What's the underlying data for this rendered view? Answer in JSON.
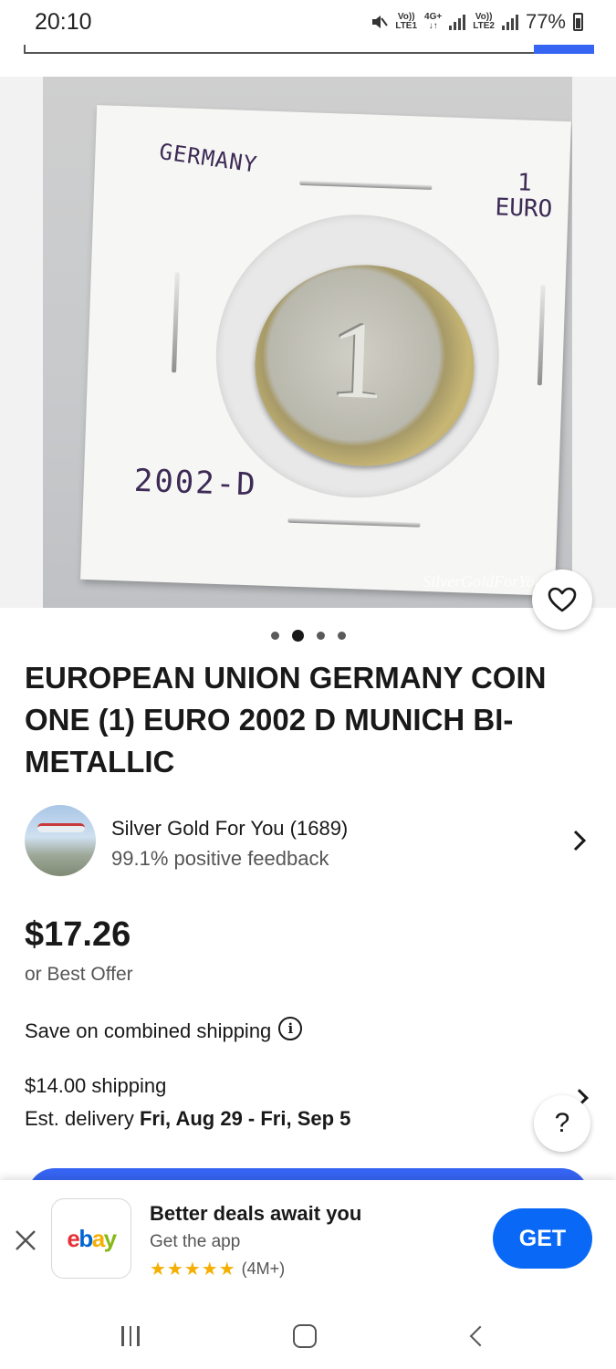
{
  "status_bar": {
    "time": "20:10",
    "sim1_label_top": "Vo))",
    "sim1_label_bottom": "LTE1",
    "network_top": "4G+",
    "network_bottom": "↓↑",
    "sim2_label_top": "Vo))",
    "sim2_label_bottom": "LTE2",
    "battery": "77%"
  },
  "gallery": {
    "photo": {
      "country_text": "GERMANY",
      "denomination_number": "1",
      "denomination_unit": "EURO",
      "year_text": "2002-D",
      "watermark": "SilverGoldForYou EB"
    },
    "dots_count": 4,
    "active_dot": 1
  },
  "listing": {
    "title": "EUROPEAN UNION GERMANY COIN ONE (1) EURO 2002 D MUNICH BI-METALLIC",
    "seller_name": "Silver Gold For You (1689)",
    "seller_feedback": "99.1% positive feedback",
    "price": "$17.26",
    "best_offer": "or Best Offer",
    "combined_shipping": "Save on combined shipping",
    "shipping_cost": "$14.00 shipping",
    "delivery_prefix": "Est. delivery ",
    "delivery_dates": "Fri, Aug 29 - Fri, Sep 5"
  },
  "help_button": "?",
  "app_banner": {
    "logo": {
      "e": "e",
      "b": "b",
      "a": "a",
      "y": "y"
    },
    "title": "Better deals await you",
    "subtitle": "Get the app",
    "stars": "★★★★★",
    "rating_count": "(4M+)",
    "get_label": "GET"
  },
  "colors": {
    "primary_blue": "#3665f3",
    "get_button": "#0968f6",
    "stars": "#f5af02"
  }
}
